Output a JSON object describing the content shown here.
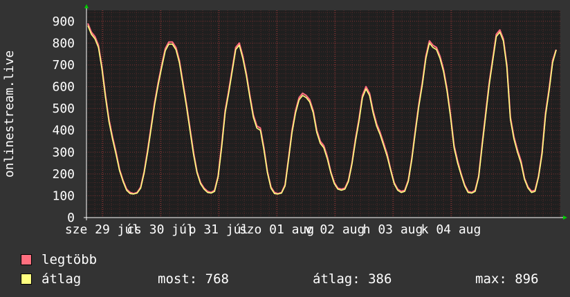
{
  "chart_data": {
    "type": "line",
    "ylabel": "onlinestream.live",
    "ylim": [
      0,
      950
    ],
    "y_ticks": [
      "0",
      "100",
      "200",
      "300",
      "400",
      "500",
      "600",
      "700",
      "800",
      "900"
    ],
    "x_tick_labels": [
      "sze 29 júl",
      "cs 30 júl",
      "p 31 júl",
      "szo 01 aug",
      "v 02 aug",
      "h 03 aug",
      "k 04 aug"
    ],
    "grid": true,
    "legend_position": "bottom-left",
    "series": [
      {
        "name": "legtöbb",
        "color": "#ff6f7f",
        "values": [
          890,
          850,
          830,
          790,
          690,
          560,
          450,
          370,
          300,
          220,
          170,
          130,
          115,
          110,
          115,
          140,
          210,
          310,
          420,
          530,
          620,
          700,
          775,
          805,
          805,
          780,
          720,
          620,
          520,
          410,
          300,
          210,
          160,
          135,
          120,
          115,
          125,
          190,
          330,
          490,
          580,
          680,
          780,
          800,
          740,
          660,
          560,
          470,
          420,
          410,
          320,
          210,
          140,
          115,
          110,
          115,
          150,
          270,
          400,
          490,
          550,
          570,
          560,
          540,
          490,
          400,
          350,
          330,
          280,
          210,
          160,
          135,
          130,
          135,
          170,
          250,
          360,
          450,
          560,
          600,
          570,
          490,
          430,
          390,
          340,
          290,
          220,
          160,
          130,
          120,
          125,
          170,
          270,
          400,
          520,
          620,
          740,
          810,
          790,
          780,
          740,
          680,
          590,
          470,
          330,
          260,
          200,
          150,
          120,
          115,
          125,
          190,
          340,
          480,
          620,
          730,
          840,
          860,
          820,
          700,
          460,
          370,
          310,
          260,
          180,
          140,
          120,
          125,
          190,
          300,
          480,
          590,
          720,
          770
        ]
      },
      {
        "name": "átlag",
        "color": "#ffff80",
        "values": [
          880,
          840,
          820,
          780,
          680,
          550,
          440,
          360,
          290,
          215,
          165,
          125,
          110,
          108,
          112,
          135,
          205,
          300,
          410,
          520,
          610,
          690,
          765,
          795,
          795,
          770,
          710,
          610,
          510,
          400,
          290,
          205,
          155,
          130,
          115,
          112,
          120,
          185,
          320,
          480,
          570,
          670,
          770,
          790,
          730,
          650,
          550,
          460,
          410,
          400,
          310,
          205,
          135,
          110,
          108,
          112,
          145,
          265,
          390,
          480,
          540,
          560,
          550,
          530,
          480,
          390,
          340,
          320,
          270,
          205,
          155,
          130,
          125,
          130,
          165,
          245,
          350,
          440,
          550,
          590,
          560,
          480,
          420,
          380,
          330,
          280,
          215,
          155,
          125,
          115,
          120,
          165,
          265,
          390,
          510,
          610,
          730,
          800,
          780,
          770,
          730,
          670,
          580,
          460,
          320,
          250,
          195,
          145,
          115,
          112,
          120,
          185,
          330,
          470,
          610,
          720,
          830,
          850,
          810,
          690,
          450,
          360,
          300,
          250,
          175,
          135,
          115,
          120,
          185,
          290,
          470,
          580,
          710,
          768
        ]
      }
    ],
    "stats": [
      {
        "label": "most:",
        "value": "768"
      },
      {
        "label": "átlag:",
        "value": "386"
      },
      {
        "label": "max:",
        "value": "896"
      }
    ]
  },
  "colors": {
    "background": "#333333",
    "plot_background": "#1f1f1f",
    "grid": "#ff4a4a",
    "axis": "#ffffff",
    "arrow": "#00cc00"
  }
}
